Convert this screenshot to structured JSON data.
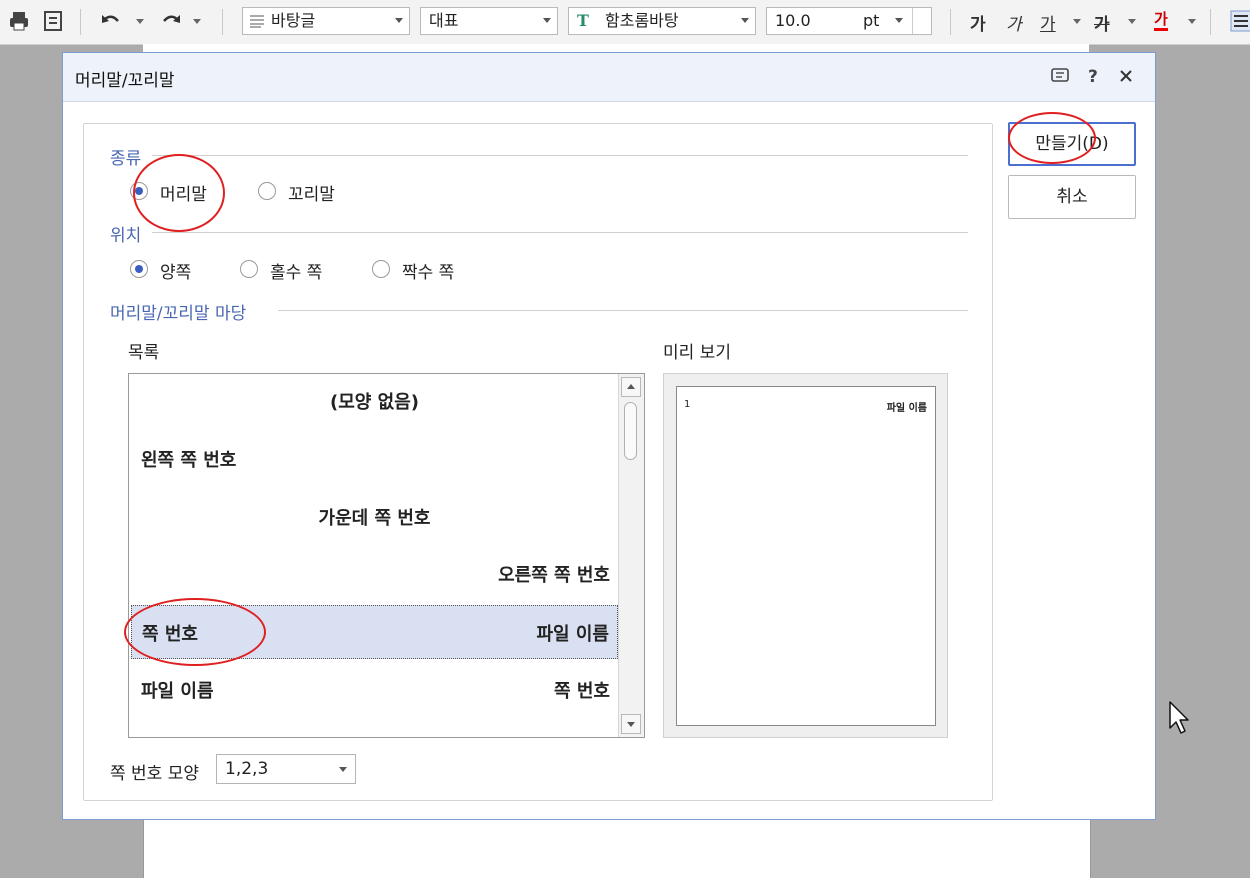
{
  "toolbar": {
    "style_combo": "바탕글",
    "lang_combo": "대표",
    "font_combo": "함초롬바탕",
    "font_size": "10.0",
    "font_unit": "pt",
    "bold_glyph": "가",
    "italic_glyph": "가",
    "underline_glyph": "가",
    "strike_glyph": "가",
    "color_glyph": "가"
  },
  "dialog": {
    "title": "머리말/꼬리말",
    "type_section": "종류",
    "type_options": [
      "머리말",
      "꼬리말"
    ],
    "position_section": "위치",
    "position_options": [
      "양쪽",
      "홀수 쪽",
      "짝수 쪽"
    ],
    "field_section": "머리말/꼬리말 마당",
    "list_label": "목록",
    "preview_label": "미리 보기",
    "list_items": [
      {
        "left": "",
        "center": "(모양 없음)",
        "right": ""
      },
      {
        "left": "왼쪽 쪽 번호",
        "center": "",
        "right": ""
      },
      {
        "left": "",
        "center": "가운데 쪽 번호",
        "right": ""
      },
      {
        "left": "",
        "center": "",
        "right": "오른쪽 쪽 번호"
      },
      {
        "left": "쪽 번호",
        "center": "",
        "right": "파일 이름"
      },
      {
        "left": "파일 이름",
        "center": "",
        "right": "쪽 번호"
      }
    ],
    "selected_index": 4,
    "preview": {
      "left": "1",
      "right": "파일 이름"
    },
    "page_number_format_label": "쪽 번호 모양",
    "page_number_format_value": "1,2,3",
    "create_button": "만들기(D)",
    "cancel_button": "취소"
  },
  "colors": {
    "accent": "#3b5fc0",
    "section_label": "#4a68b2",
    "annotation": "#e02020"
  }
}
